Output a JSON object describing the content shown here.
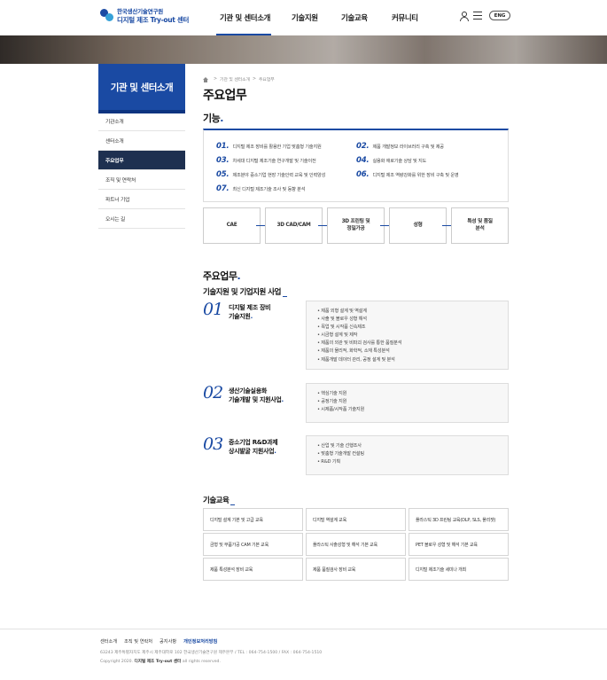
{
  "header": {
    "logo_top": "한국생산기술연구원",
    "logo_bottom": "디지털 제조 Try-out 센터",
    "nav": [
      "기관 및 센터소개",
      "기술지원",
      "기술교육",
      "커뮤니티"
    ],
    "lang_button": "ENG"
  },
  "sidebar": {
    "title": "기관 및 센터소개",
    "items": [
      "기관소개",
      "센터소개",
      "주요업무",
      "조직 및 연락처",
      "파트너 기업",
      "오시는 길"
    ],
    "active_index": 2
  },
  "breadcrumb": [
    "기관 및 센터소개",
    "주요업무"
  ],
  "page_title": "주요업무",
  "functions": {
    "title": "기능",
    "items": [
      {
        "num": "01.",
        "text": "디지털 제조 장비를 활용한 기업 맞춤형 기술지원"
      },
      {
        "num": "02.",
        "text": "제품 개발정보 라이브러리 구축 및 제공"
      },
      {
        "num": "03.",
        "text": "차세대 디지털 제조기술 연구개발 및 기술이전"
      },
      {
        "num": "04.",
        "text": "실용화 애로기술 상담 및 지도"
      },
      {
        "num": "05.",
        "text": "제조분야 중소기업 현장 기술인력 교육 및 인력양성"
      },
      {
        "num": "06.",
        "text": "디지털 제조 역량강화를 위한 장비 구축 및 운영"
      },
      {
        "num": "07.",
        "text": "최신 디지털 제조기술 조사 및 동향 분석"
      }
    ],
    "flow": [
      "CAE",
      "3D CAD/CAM",
      "3D 프린팅 및\n정밀가공",
      "성형",
      "특성 및 품질\n분석"
    ]
  },
  "business": {
    "title": "주요업무",
    "subtitle": "기술지원 및 기업지원 사업",
    "items": [
      {
        "num": "01",
        "name": [
          "디지털 제조 장비",
          "기술지원"
        ],
        "details": [
          "• 제품 외형 설계 및 역설계",
          "• 사출 및 블로우 성형 해석",
          "• 목업 및 시작품 신속제조",
          "• 시금형 설계 및 제작",
          "• 제품의 외관 및 비파괴 검사를 통한 품질분석",
          "• 제품의 물리적, 화학적, 소재 특성분석",
          "• 제품개발 데이터 관리, 공정 설계 및 분석"
        ]
      },
      {
        "num": "02",
        "name": [
          "생산기술실용화",
          "기술개발 및 지원사업"
        ],
        "details": [
          "• 핵심기술 지원",
          "• 공정기술 지원",
          "• 시제품/시작품 기술지원"
        ]
      },
      {
        "num": "03",
        "name": [
          "중소기업 R&D과제",
          "상시발굴 지원사업"
        ],
        "details": [
          "• 산업 및 기술 선행조사",
          "• 맞춤형 기술개발 컨설팅",
          "• R&D 기획"
        ]
      }
    ]
  },
  "education": {
    "title": "기술교육",
    "items": [
      "디지털 설계 기본 및 고급 교육",
      "디지털 역설계 교육",
      "플라스틱 3D 프린팅 교육(DLP, SLS, 폴리젯)",
      "금형 및 부품가공 CAM 기본 교육",
      "플라스틱 사출성형 및 해석 기본 교육",
      "PET 블로우 성형 및 해석 기본 교육",
      "제품 특성분석 장비 교육",
      "제품 품질검사 장비 교육",
      "디지털 제조기술 세미나 개최"
    ]
  },
  "footer": {
    "links": [
      "센터소개",
      "조직 및 연락처",
      "공지사항",
      "개인정보처리방침"
    ],
    "address": "63243 제주특별자치도 제주시 제주대학로 102 한국생산기술연구원 제주본부   /  TEL : 064-754-1500   /  FAX : 064-754-1510",
    "copyright_prefix": "Copyright 2020.",
    "copyright_name": "디지털 제조 Try-out 센터",
    "copyright_suffix": "all rights reserved."
  }
}
